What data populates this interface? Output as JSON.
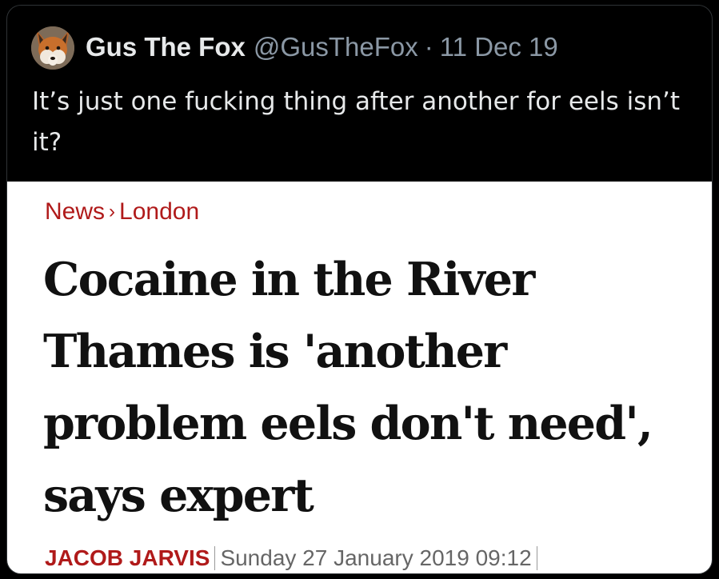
{
  "tweet": {
    "display_name": "Gus The Fox",
    "handle": "@GusTheFox",
    "separator": "·",
    "date": "11 Dec 19",
    "text": "It’s just one fucking thing after another for eels isn’t it?",
    "avatar_icon": "fox-avatar-icon"
  },
  "article": {
    "breadcrumb": {
      "section": "News",
      "separator_icon": "chevron-right-icon",
      "subsection": "London"
    },
    "headline": "Cocaine in the River Thames is 'another problem eels don't need', says expert",
    "author": "JACOB JARVIS",
    "published": "Sunday 27 January 2019 09:12"
  },
  "colors": {
    "background": "#000000",
    "tweet_text": "#e7e9ea",
    "secondary_text": "#8b98a5",
    "accent_red": "#b01a1a",
    "headline": "#111111"
  }
}
